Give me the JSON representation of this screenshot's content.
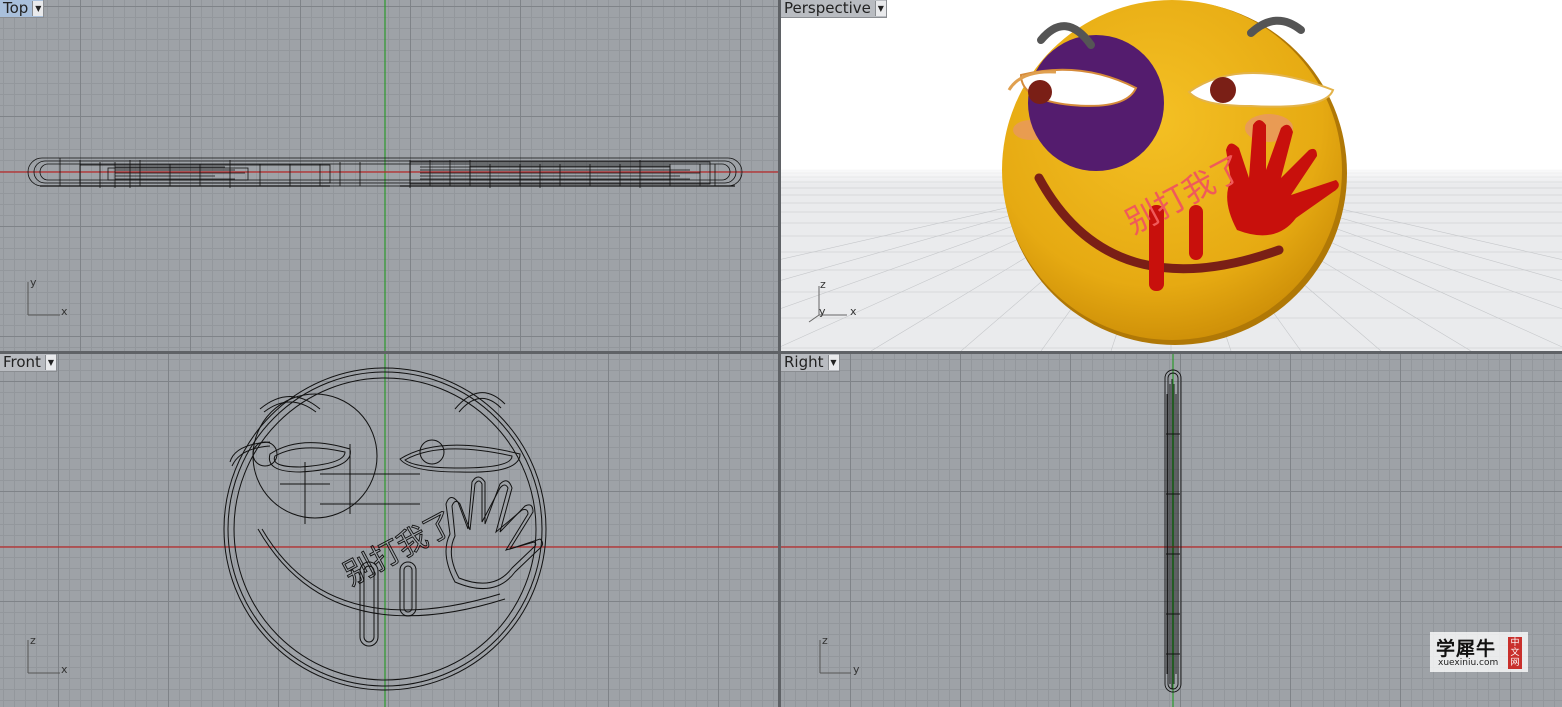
{
  "viewports": {
    "top": {
      "label": "Top",
      "axis_h": "x",
      "axis_v": "y"
    },
    "perspective": {
      "label": "Perspective",
      "axis_h": "x",
      "axis_v": "z",
      "axis_depth": "y"
    },
    "front": {
      "label": "Front",
      "axis_h": "x",
      "axis_v": "z"
    },
    "right": {
      "label": "Right",
      "axis_h": "y",
      "axis_v": "z"
    }
  },
  "model": {
    "text": "别打我了"
  },
  "colors": {
    "x_axis": "#b7282a",
    "y_axis": "#2c9a2c",
    "face": "#e6aa12",
    "bruise": "#541c6e",
    "blood": "#c8100c",
    "text": "#f05a5a",
    "active_tab": "#a9c0dc"
  },
  "icons": {
    "dropdown": "chevron-down-icon"
  },
  "watermark": {
    "name": "学犀牛",
    "url": "xuexiniu.com",
    "seal": [
      "中",
      "文",
      "网"
    ]
  }
}
